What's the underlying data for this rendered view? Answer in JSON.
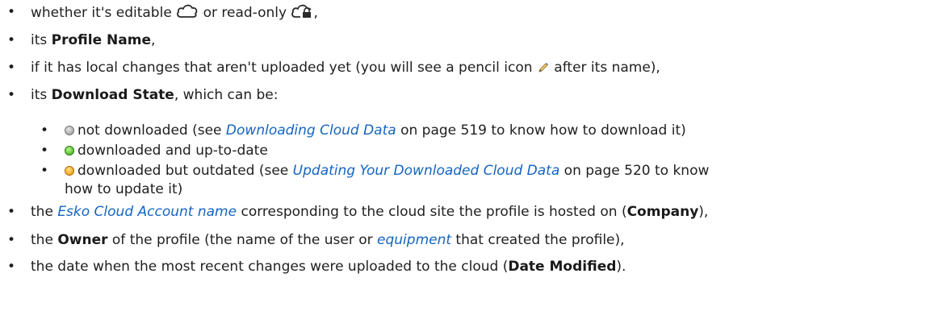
{
  "items": [
    {
      "t1": "whether it's editable ",
      "t2": " or read-only ",
      "t3": ","
    },
    {
      "t1": "its ",
      "b1": "Profile Name",
      "t2": ","
    },
    {
      "t1": "if it has local changes that aren't uploaded yet (you will see a pencil icon ",
      "t2": " after its name),"
    },
    {
      "t1": "its ",
      "b1": "Download State",
      "t2": ", which can be:"
    },
    {
      "t1": "not downloaded (see ",
      "link": "Downloading Cloud Data",
      "t2": " on page 519 to know how to download it)"
    },
    {
      "t1": "downloaded and up-to-date"
    },
    {
      "t1": "downloaded but outdated (see ",
      "link": "Updating Your Downloaded Cloud Data",
      "t2": " on page 520 to know"
    },
    {
      "t1": "how to update it)"
    },
    {
      "t1": "the ",
      "link": "Esko Cloud Account name",
      "t2": " corresponding to the cloud site the profile is hosted on (",
      "b1": "Company",
      "t3": "),"
    },
    {
      "t1": "the ",
      "b1": "Owner",
      "t2": " of the profile (the name of the user or ",
      "link": "equipment",
      "t3": " that created the profile),"
    },
    {
      "t1": "the date when the most recent changes were uploaded to the cloud (",
      "b1": "Date Modified",
      "t2": ")."
    }
  ],
  "bullet": "•",
  "icons": [
    "cloud-outline-icon",
    "cloud-lock-icon",
    "pencil-icon",
    "gray-status-dot-icon",
    "green-status-dot-icon",
    "orange-status-dot-icon"
  ],
  "colors": {
    "link": "#1565c0",
    "text": "#1f1f1f"
  }
}
